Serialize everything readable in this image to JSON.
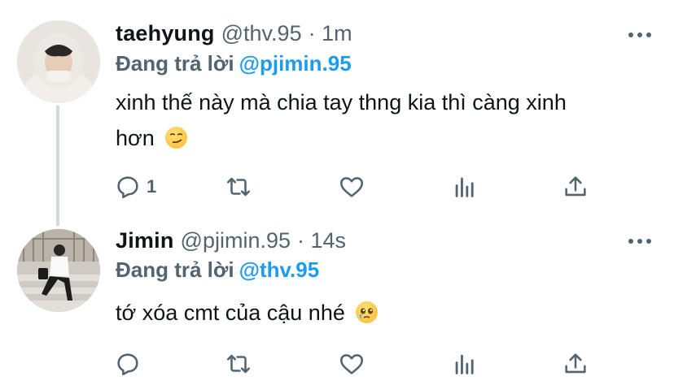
{
  "tweets": [
    {
      "name": "taehyung",
      "handle": "@thv.95",
      "time": "· 1m",
      "replying_label": "Đang trả lời",
      "replying_to": "@pjimin.95",
      "text_line1": "xinh thế này mà chia tay thng kia thì càng xinh",
      "text_line2": "hơn",
      "emoji": "smirk-emoji",
      "reply_count": "1"
    },
    {
      "name": "Jimin",
      "handle": "@pjimin.95",
      "time": "· 14s",
      "replying_label": "Đang trả lời",
      "replying_to": "@thv.95",
      "text_line1": "tớ xóa cmt của cậu nhé",
      "emoji": "pleading-emoji",
      "reply_count": ""
    }
  ],
  "colors": {
    "link": "#1d9bf0",
    "secondary": "#536471",
    "thread_line": "#cfd9de"
  },
  "icons": [
    "reply-icon",
    "retweet-icon",
    "like-icon",
    "analytics-icon",
    "share-icon",
    "more-options-icon"
  ]
}
